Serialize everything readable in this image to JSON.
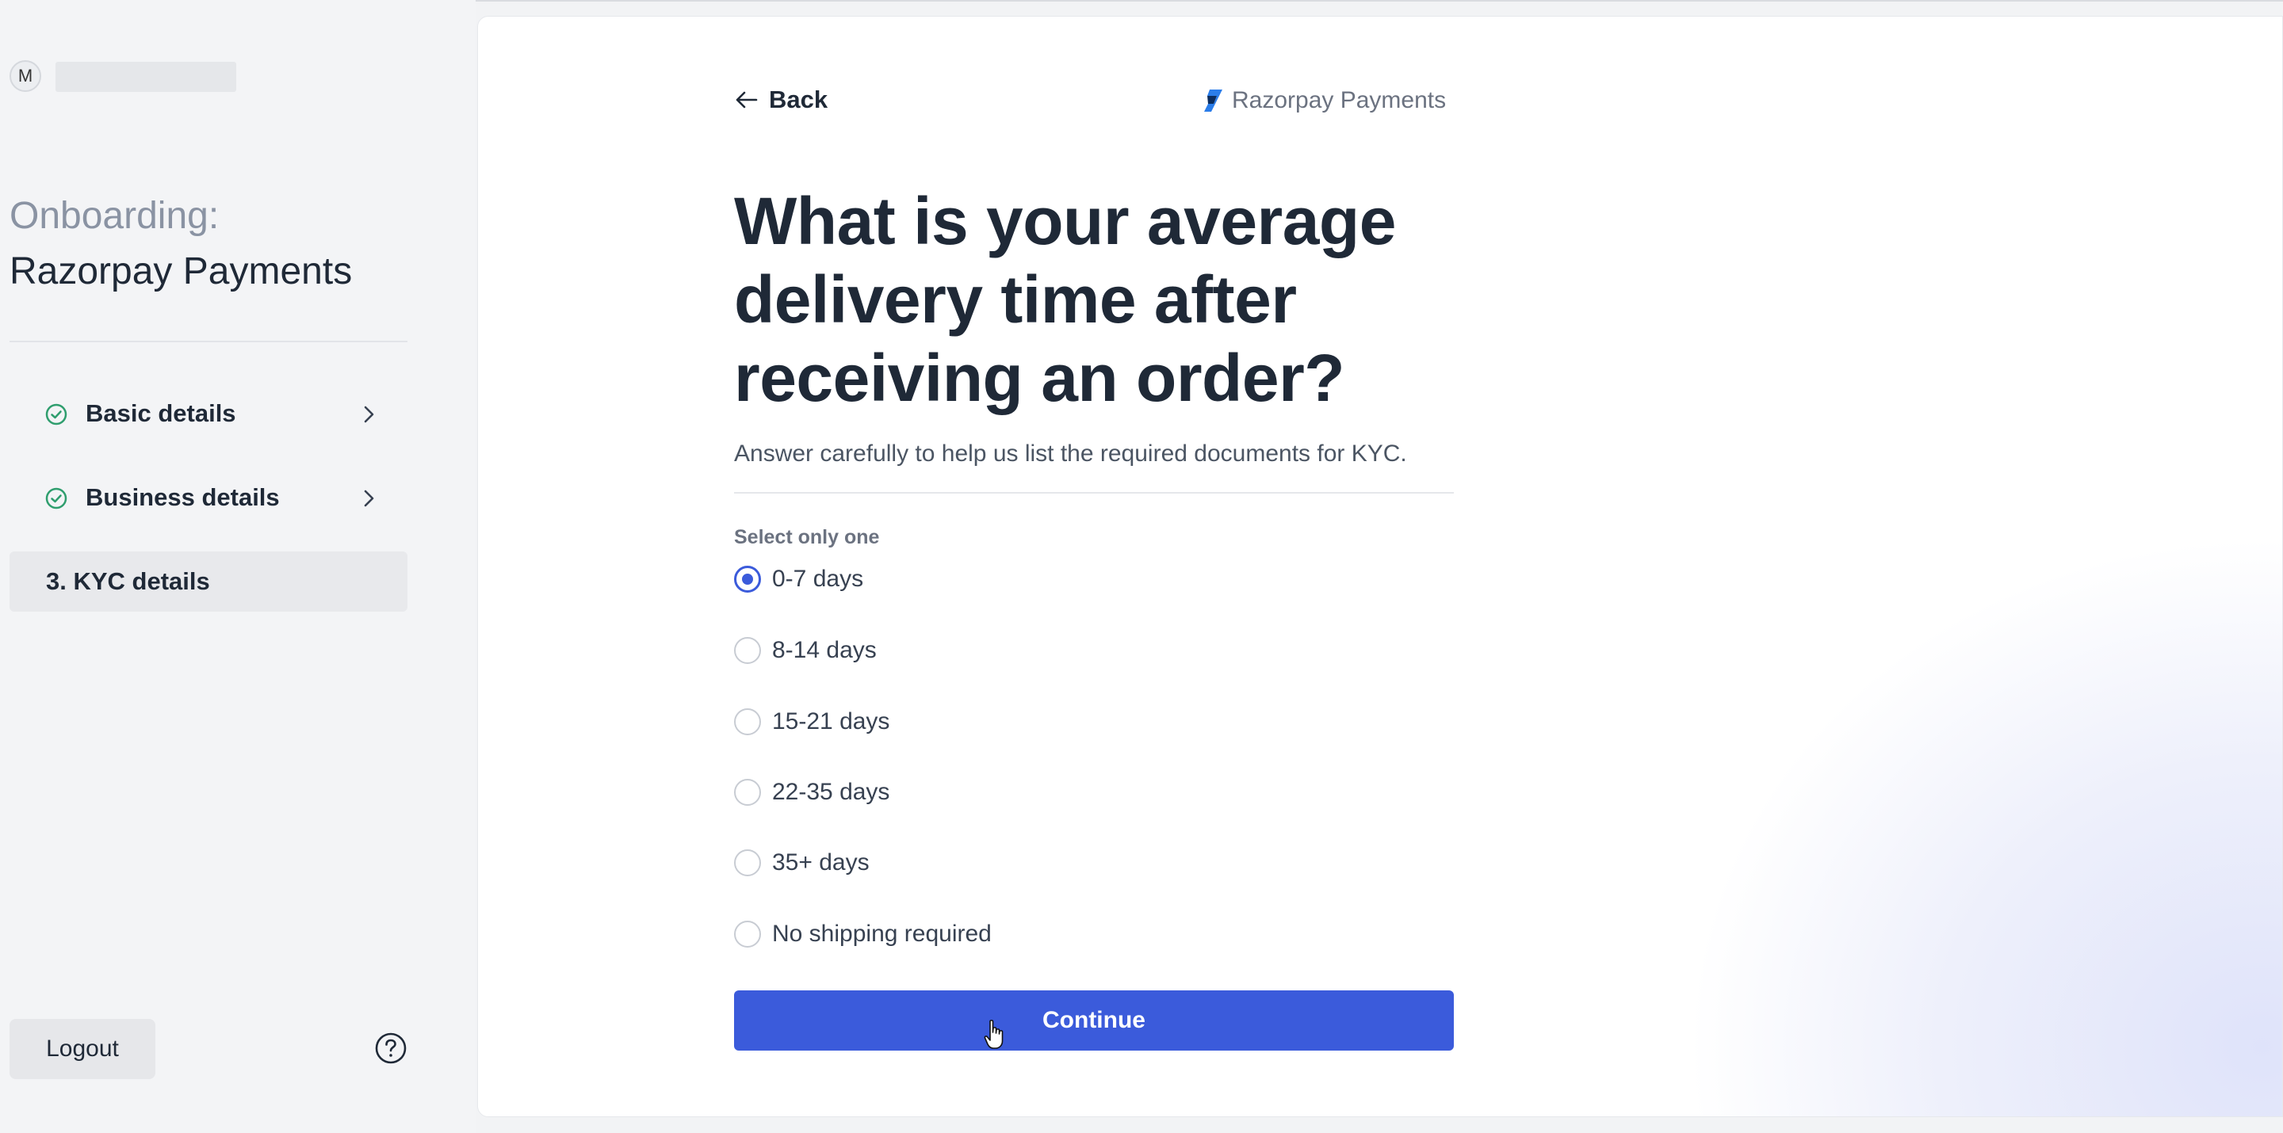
{
  "user": {
    "avatar_initial": "M"
  },
  "sidebar": {
    "onboarding_label": "Onboarding:",
    "onboarding_name": "Razorpay Payments",
    "steps": [
      {
        "label": "Basic details",
        "status": "complete",
        "icon": "check-circle-icon"
      },
      {
        "label": "Business details",
        "status": "complete",
        "icon": "check-circle-icon"
      },
      {
        "label": "3. KYC details",
        "status": "active"
      }
    ],
    "logout_label": "Logout",
    "help_icon": "question-circle-icon"
  },
  "main": {
    "back_label": "Back",
    "brand_name": "Razorpay Payments",
    "question": "What is your average delivery time after receiving an order?",
    "subtitle": "Answer carefully to help us list the required documents for KYC.",
    "select_hint": "Select only one",
    "options": [
      {
        "label": "0-7 days",
        "selected": true
      },
      {
        "label": "8-14 days",
        "selected": false
      },
      {
        "label": "15-21 days",
        "selected": false
      },
      {
        "label": "22-35 days",
        "selected": false
      },
      {
        "label": "35+ days",
        "selected": false
      },
      {
        "label": "No shipping required",
        "selected": false
      }
    ],
    "continue_label": "Continue"
  },
  "colors": {
    "accent": "#3b5bdb",
    "check_green": "#2f9e6e",
    "text_dark": "#1f2937",
    "text_muted": "#6b7280"
  }
}
